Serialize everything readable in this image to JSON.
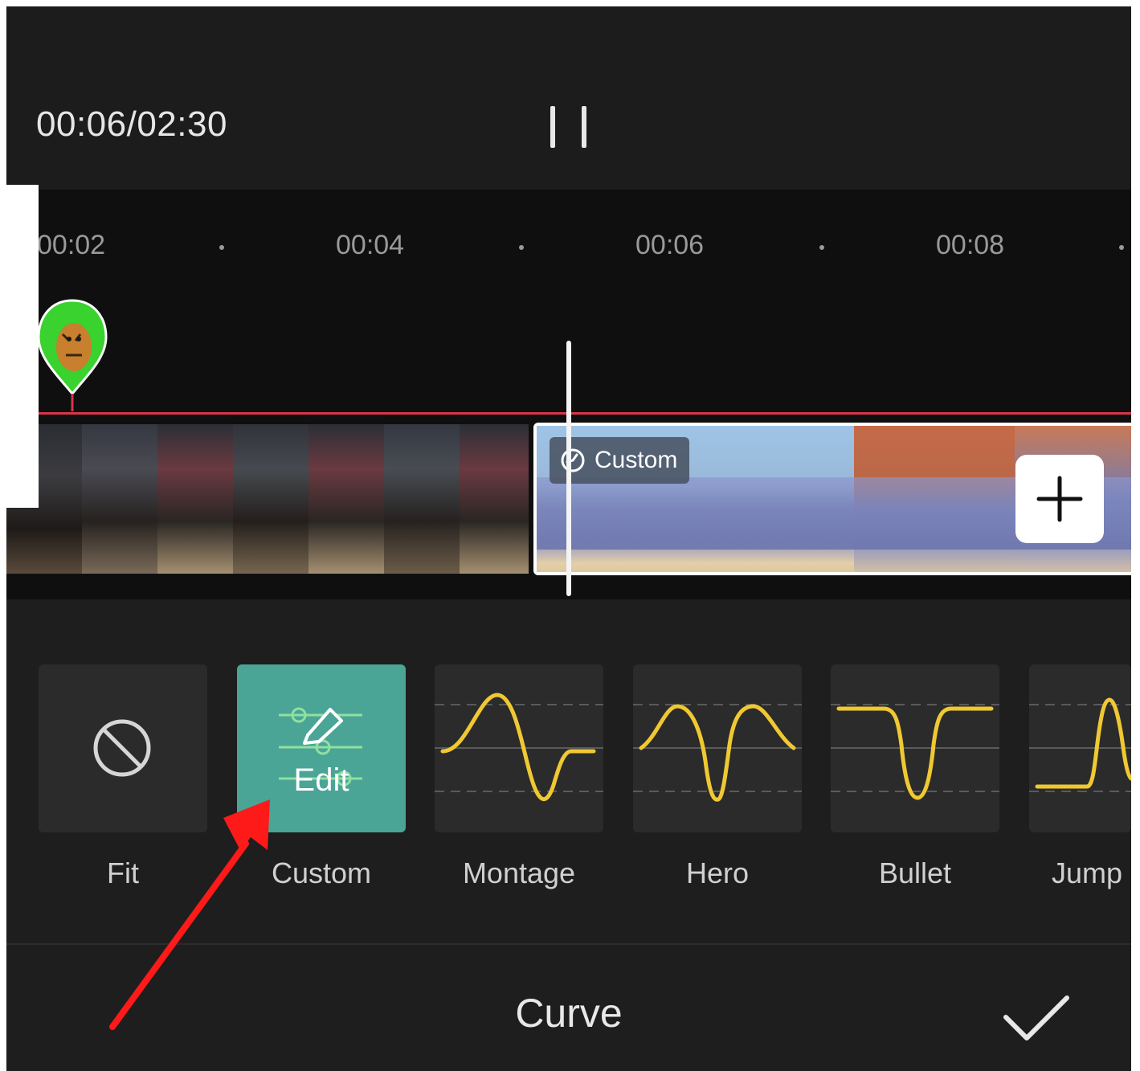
{
  "player": {
    "time_display": "00:06/02:30",
    "pause_icon": "pause-icon"
  },
  "timeline": {
    "ruler": [
      "00:02",
      "00:04",
      "00:06",
      "00:08"
    ],
    "clip_tag": "Custom",
    "clip_tag_icon": "speed-curve-icon",
    "add_icon": "plus-icon"
  },
  "presets": {
    "items": [
      {
        "label": "Fit",
        "icon": "none-icon"
      },
      {
        "label": "Custom",
        "overlay": "Edit",
        "selected": true,
        "icon": "edit-pencil-icon"
      },
      {
        "label": "Montage",
        "icon": "montage-curve-icon"
      },
      {
        "label": "Hero",
        "icon": "hero-curve-icon"
      },
      {
        "label": "Bullet",
        "icon": "bullet-curve-icon"
      },
      {
        "label": "Jump",
        "icon": "jump-curve-icon"
      }
    ]
  },
  "bottom": {
    "title": "Curve",
    "confirm_icon": "checkmark-icon"
  },
  "colors": {
    "accent": "#4aa596",
    "curve": "#f0c832",
    "marker_line": "#d8364b",
    "annotation_arrow": "#ff1a1a"
  }
}
